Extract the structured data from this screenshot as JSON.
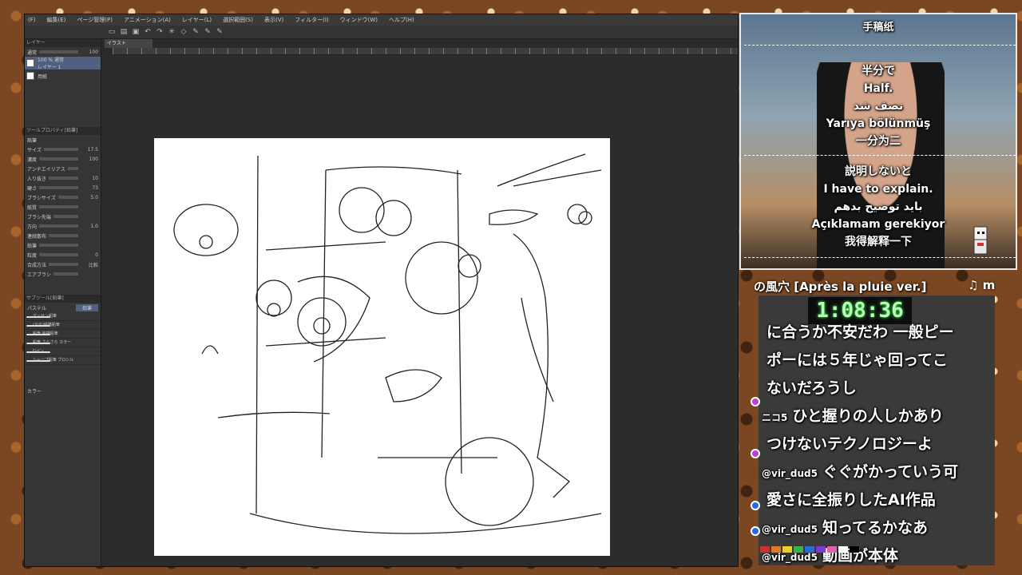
{
  "menu": [
    "(F)",
    "編集(E)",
    "ページ管理(P)",
    "アニメーション(A)",
    "レイヤー(L)",
    "選択範囲(S)",
    "表示(V)",
    "フィルター(I)",
    "ウィンドウ(W)",
    "ヘルプ(H)"
  ],
  "left_panel": {
    "layer_header": "レイヤー",
    "blend_mode": "通常",
    "opacity": "100",
    "layers": [
      {
        "name": "100 % 通常",
        "sub": "レイヤー 1"
      },
      {
        "name": "用紙"
      }
    ],
    "tool_props_header": "ツールプロパティ[鉛筆]",
    "brush_name": "鉛筆",
    "props": [
      {
        "label": "サイズ",
        "value": "17.5"
      },
      {
        "label": "濃度",
        "value": "100"
      },
      {
        "label": "アンチエイリアス",
        "value": ""
      },
      {
        "label": "入り抜き",
        "value": "10"
      },
      {
        "label": "硬さ",
        "value": "73"
      },
      {
        "label": "ブラシサイズ",
        "value": "5.0"
      },
      {
        "label": "紙質",
        "value": ""
      },
      {
        "label": "ブラシ先端",
        "value": ""
      },
      {
        "label": "方向",
        "value": "1.0"
      },
      {
        "label": "連続散布",
        "value": ""
      },
      {
        "label": "鉛筆",
        "value": ""
      },
      {
        "label": "粒度",
        "value": "0"
      },
      {
        "label": "合成方法",
        "value": "比較"
      },
      {
        "label": "エアブラシ",
        "value": ""
      }
    ],
    "subtool_header": "サブツール[鉛筆]",
    "subtool_tabs": [
      "パステル",
      "鉛筆"
    ],
    "brushes": [
      "デッサン鉛筆",
      "(やや)絵描鉛筆",
      "鉛筆 絵描鉛筆",
      "鉛筆 さらさら カラー",
      "Gペン",
      "シャープ鉛筆 ブロシル"
    ],
    "color_header": "カラー"
  },
  "doc_tab": "イラスト",
  "subs": {
    "title": "手稿纸",
    "block_a": [
      "半分で",
      "Half.",
      "نصف شد",
      "Yarıya bölünmüş",
      "一分为二"
    ],
    "block_b": [
      "説明しないと",
      "I have to explain.",
      "باید توضیح بدهم",
      "Açıklamam gerekiyor",
      "我得解释一下"
    ]
  },
  "song": "の風穴 [Après la pluie ver.]",
  "song_icon": "♫ m",
  "timer": "1:08:36",
  "chat": [
    {
      "user": "",
      "text": "に合うか不安だわ 一般ピー"
    },
    {
      "user": "",
      "text": "ポーには５年じゃ回ってこ"
    },
    {
      "user": "",
      "text": "ないだろうし"
    },
    {
      "user": "ニコ5",
      "text": "ひと握りの人しかあり"
    },
    {
      "user": "",
      "text": "つけないテクノロジーよ"
    },
    {
      "user": "@vir_dud5",
      "text": "ぐぐがかっていう可"
    },
    {
      "user": "",
      "text": "愛さに全振りしたAI作品"
    },
    {
      "user": "@vir_dud5",
      "text": "知ってるかなあ"
    },
    {
      "user": "@vir_dud5",
      "text": "動画が本体"
    }
  ],
  "colors": {
    "palette": [
      "#d23030",
      "#e07a20",
      "#e8d02a",
      "#37b34a",
      "#2b6ad8",
      "#7a3ad8",
      "#e060b0",
      "#ffffff",
      "#000000"
    ],
    "timer_glow": "#39ff5a",
    "selection": "#4f6080"
  },
  "icons": [
    "new-icon",
    "open-icon",
    "save-icon",
    "undo-icon",
    "redo-icon",
    "select-icon",
    "transform-icon",
    "pen-icon"
  ]
}
